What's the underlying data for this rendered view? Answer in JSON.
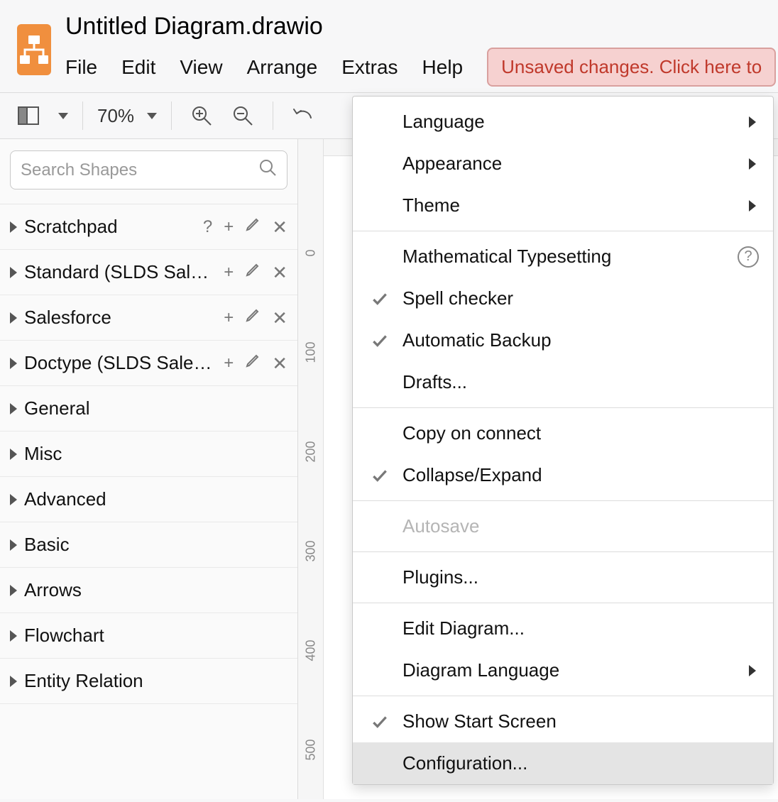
{
  "header": {
    "title": "Untitled Diagram.drawio",
    "menus": {
      "file": "File",
      "edit": "Edit",
      "view": "View",
      "arrange": "Arrange",
      "extras": "Extras",
      "help": "Help"
    },
    "unsaved": "Unsaved changes. Click here to"
  },
  "toolbar": {
    "zoom": "70%"
  },
  "sidebar": {
    "search_placeholder": "Search Shapes",
    "items": [
      {
        "label": "Scratchpad",
        "actions": [
          "?",
          "+",
          "edit",
          "x"
        ]
      },
      {
        "label": "Standard (SLDS Sal…",
        "actions": [
          "+",
          "edit",
          "x"
        ]
      },
      {
        "label": "Salesforce",
        "actions": [
          "+",
          "edit",
          "x"
        ]
      },
      {
        "label": "Doctype (SLDS Sale…",
        "actions": [
          "+",
          "edit",
          "x"
        ]
      },
      {
        "label": "General",
        "actions": []
      },
      {
        "label": "Misc",
        "actions": []
      },
      {
        "label": "Advanced",
        "actions": []
      },
      {
        "label": "Basic",
        "actions": []
      },
      {
        "label": "Arrows",
        "actions": []
      },
      {
        "label": "Flowchart",
        "actions": []
      },
      {
        "label": "Entity Relation",
        "actions": []
      }
    ]
  },
  "ruler": {
    "v": [
      "0",
      "100",
      "200",
      "300",
      "400",
      "500"
    ]
  },
  "extras_menu": {
    "language": "Language",
    "appearance": "Appearance",
    "theme": "Theme",
    "math": "Mathematical Typesetting",
    "spell": "Spell checker",
    "backup": "Automatic Backup",
    "drafts": "Drafts...",
    "copyconnect": "Copy on connect",
    "collapse": "Collapse/Expand",
    "autosave": "Autosave",
    "plugins": "Plugins...",
    "editdiag": "Edit Diagram...",
    "diaglang": "Diagram Language",
    "startscreen": "Show Start Screen",
    "config": "Configuration..."
  }
}
